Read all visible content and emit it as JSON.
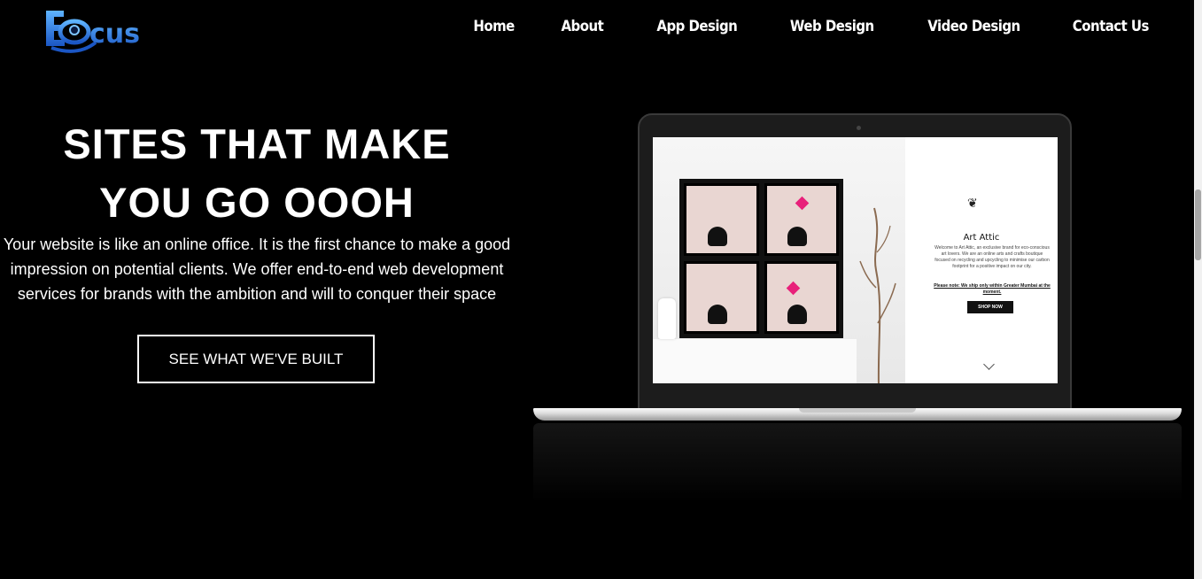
{
  "brand": {
    "logo_text": "Focus",
    "logo_letters": "cus"
  },
  "nav": {
    "items": [
      {
        "label": "Home"
      },
      {
        "label": "About"
      },
      {
        "label": "App Design"
      },
      {
        "label": "Web Design"
      },
      {
        "label": "Video Design"
      },
      {
        "label": "Contact Us"
      }
    ]
  },
  "hero": {
    "title_line1": "SITES THAT MAKE",
    "title_line2": "YOU GO OOOH",
    "description": "Your website is like an online office. It is the first chance to make a good impression on potential clients. We offer end-to-end web development services for brands with the ambition and will to conquer their space",
    "cta_label": "SEE WHAT WE'VE BUILT"
  },
  "laptop_screen": {
    "brand_title": "Art Attic",
    "brand_text": "Welcome to Art Attic, an exclusive brand for eco-conscious art lovers. We are an online arts and crafts boutique focused on recycling and upcycling to minimise our carbon footprint for a positive impact on our city.",
    "note": "Please note: We ship only within Greater Mumbai at the moment.",
    "shop_button": "SHOP NOW"
  },
  "colors": {
    "background": "#000000",
    "logo_blue": "#1e6fd9",
    "text": "#ffffff"
  }
}
